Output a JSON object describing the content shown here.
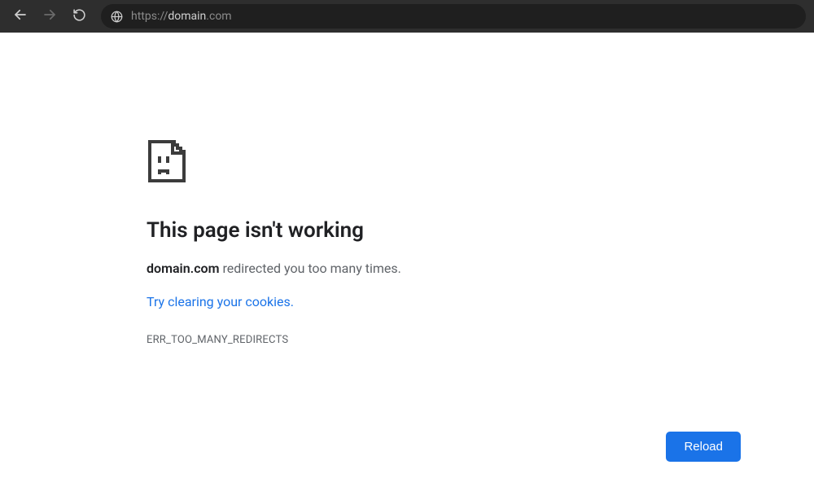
{
  "toolbar": {
    "url_scheme": "https://",
    "url_host": "domain",
    "url_tld": ".com"
  },
  "error_page": {
    "heading": "This page isn't working",
    "message_bold": "domain.com",
    "message_rest": " redirected you too many times.",
    "cookies_link_text": "Try clearing your cookies.",
    "error_code": "ERR_TOO_MANY_REDIRECTS",
    "reload_label": "Reload"
  }
}
